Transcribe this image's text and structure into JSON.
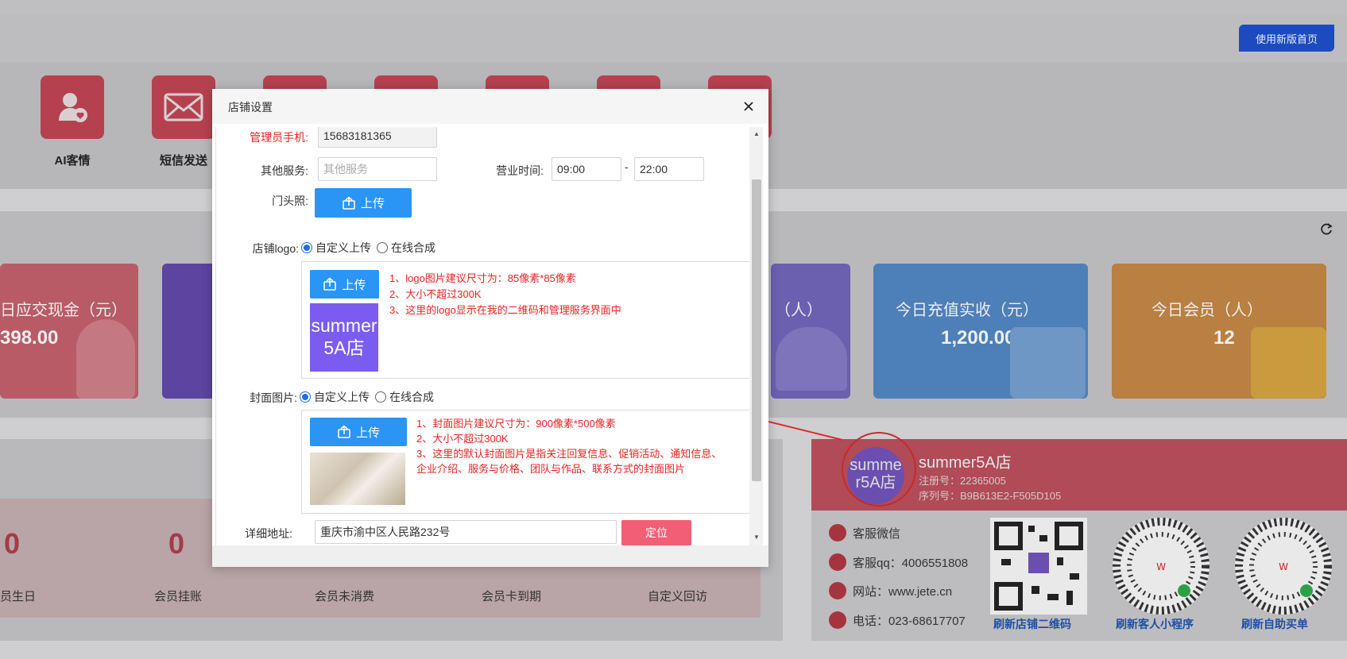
{
  "header": {
    "new_home_button": "使用新版首页"
  },
  "quick_menu": [
    {
      "label": "AI客情",
      "icon": "user-heart-icon"
    },
    {
      "label": "短信发送",
      "icon": "mail-icon"
    }
  ],
  "stats": [
    {
      "title": "日应交现金（元）",
      "value": "398.00",
      "color": "#b85b66"
    },
    {
      "title": "（人）",
      "value": "",
      "color": "#6b5fb0"
    },
    {
      "title": "今日充值实收（元）",
      "value": "1,200.00",
      "color": "#4d7fb8"
    },
    {
      "title": "今日会员（人）",
      "value": "12",
      "color": "#b98041"
    }
  ],
  "member_counts": [
    {
      "label": "员生日",
      "value": "0"
    },
    {
      "label": "会员挂账",
      "value": "0"
    },
    {
      "label": "会员未消费",
      "value": ""
    },
    {
      "label": "会员卡到期",
      "value": ""
    },
    {
      "label": "自定义回访",
      "value": ""
    }
  ],
  "shop": {
    "name": "summer5A店",
    "avatar_text": "summer5A店",
    "reg_no": "注册号：22365005",
    "serial_no": "序列号：B9B613E2-F505D105",
    "contacts": [
      {
        "icon": "wechat-icon",
        "text": "客服微信"
      },
      {
        "icon": "qq-icon",
        "text": "客服qq：4006551808"
      },
      {
        "icon": "link-icon",
        "text": "网站：www.jete.cn"
      },
      {
        "icon": "phone-icon",
        "text": "电话：023-68617707"
      }
    ],
    "qr_captions": [
      "刷新店铺二维码",
      "刷新客人小程序",
      "刷新自助买单"
    ]
  },
  "modal": {
    "title": "店铺设置",
    "admin_phone_label": "管理员手机:",
    "admin_phone_value": "15683181365",
    "other_service_label": "其他服务:",
    "other_service_placeholder": "其他服务",
    "hours_label": "营业时间:",
    "hours_start": "09:00",
    "hours_sep": "-",
    "hours_end": "22:00",
    "storefront_label": "门头照:",
    "upload_label": "上传",
    "logo_label": "店铺logo:",
    "cover_label": "封面图片:",
    "option_custom": "自定义上传",
    "option_online": "在线合成",
    "logo_preview_text": "summer5A店",
    "logo_notes": [
      "1、logo图片建议尺寸为：85像素*85像素",
      "2、大小不超过300K",
      "3、这里的logo显示在我的二维码和管理服务界面中"
    ],
    "cover_notes": [
      "1、封面图片建议尺寸为：900像素*500像素",
      "2、大小不超过300K",
      "3、这里的默认封面图片是指关注回复信息、促销活动、通知信息、企业介绍、服务与价格、团队与作品、联系方式的封面图片"
    ],
    "address_label": "详细地址:",
    "address_value": "重庆市渝中区人民路232号",
    "locate_button": "定位"
  }
}
